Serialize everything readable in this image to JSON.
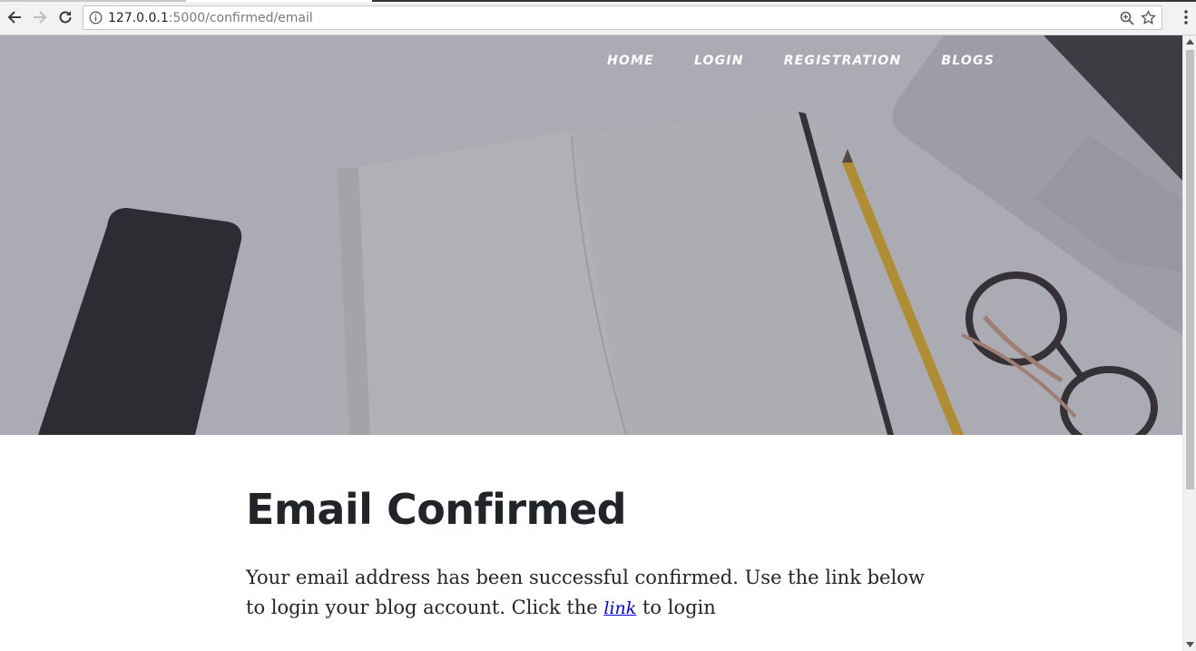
{
  "browser": {
    "url_host": "127.0.0.1",
    "url_path": ":5000/confirmed/email"
  },
  "nav": {
    "items": [
      {
        "label": "HOME"
      },
      {
        "label": "LOGIN"
      },
      {
        "label": "REGISTRATION"
      },
      {
        "label": "BLOGS"
      }
    ]
  },
  "main": {
    "title": "Email Confirmed",
    "message_before": "Your email address has been successful confirmed. Use the link below to login your blog account. Click the ",
    "link_label": "link",
    "message_after": " to login"
  }
}
